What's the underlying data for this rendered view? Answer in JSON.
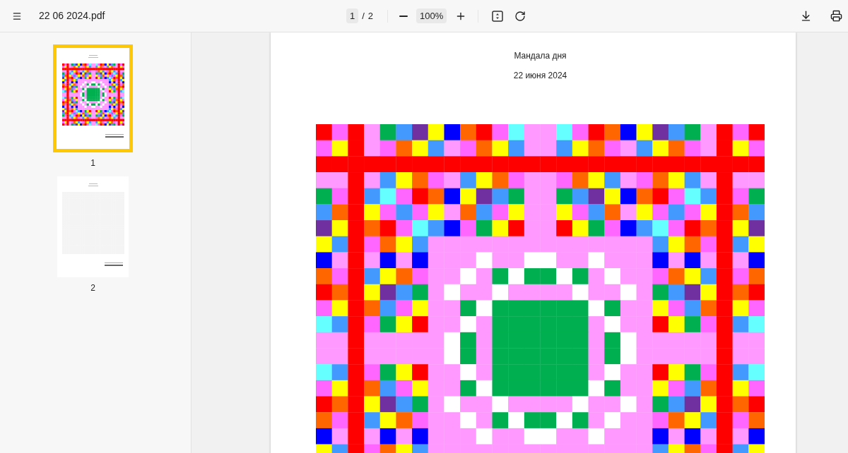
{
  "toolbar": {
    "file_name": "22 06 2024.pdf",
    "page_number": "1",
    "page_separator": "/",
    "page_count": "2",
    "zoom": "100%"
  },
  "thumbnails": [
    {
      "label": "1",
      "selected": true
    },
    {
      "label": "2",
      "selected": false
    }
  ],
  "page": {
    "title": "Мандала дня",
    "date": "22 июня 2024"
  }
}
